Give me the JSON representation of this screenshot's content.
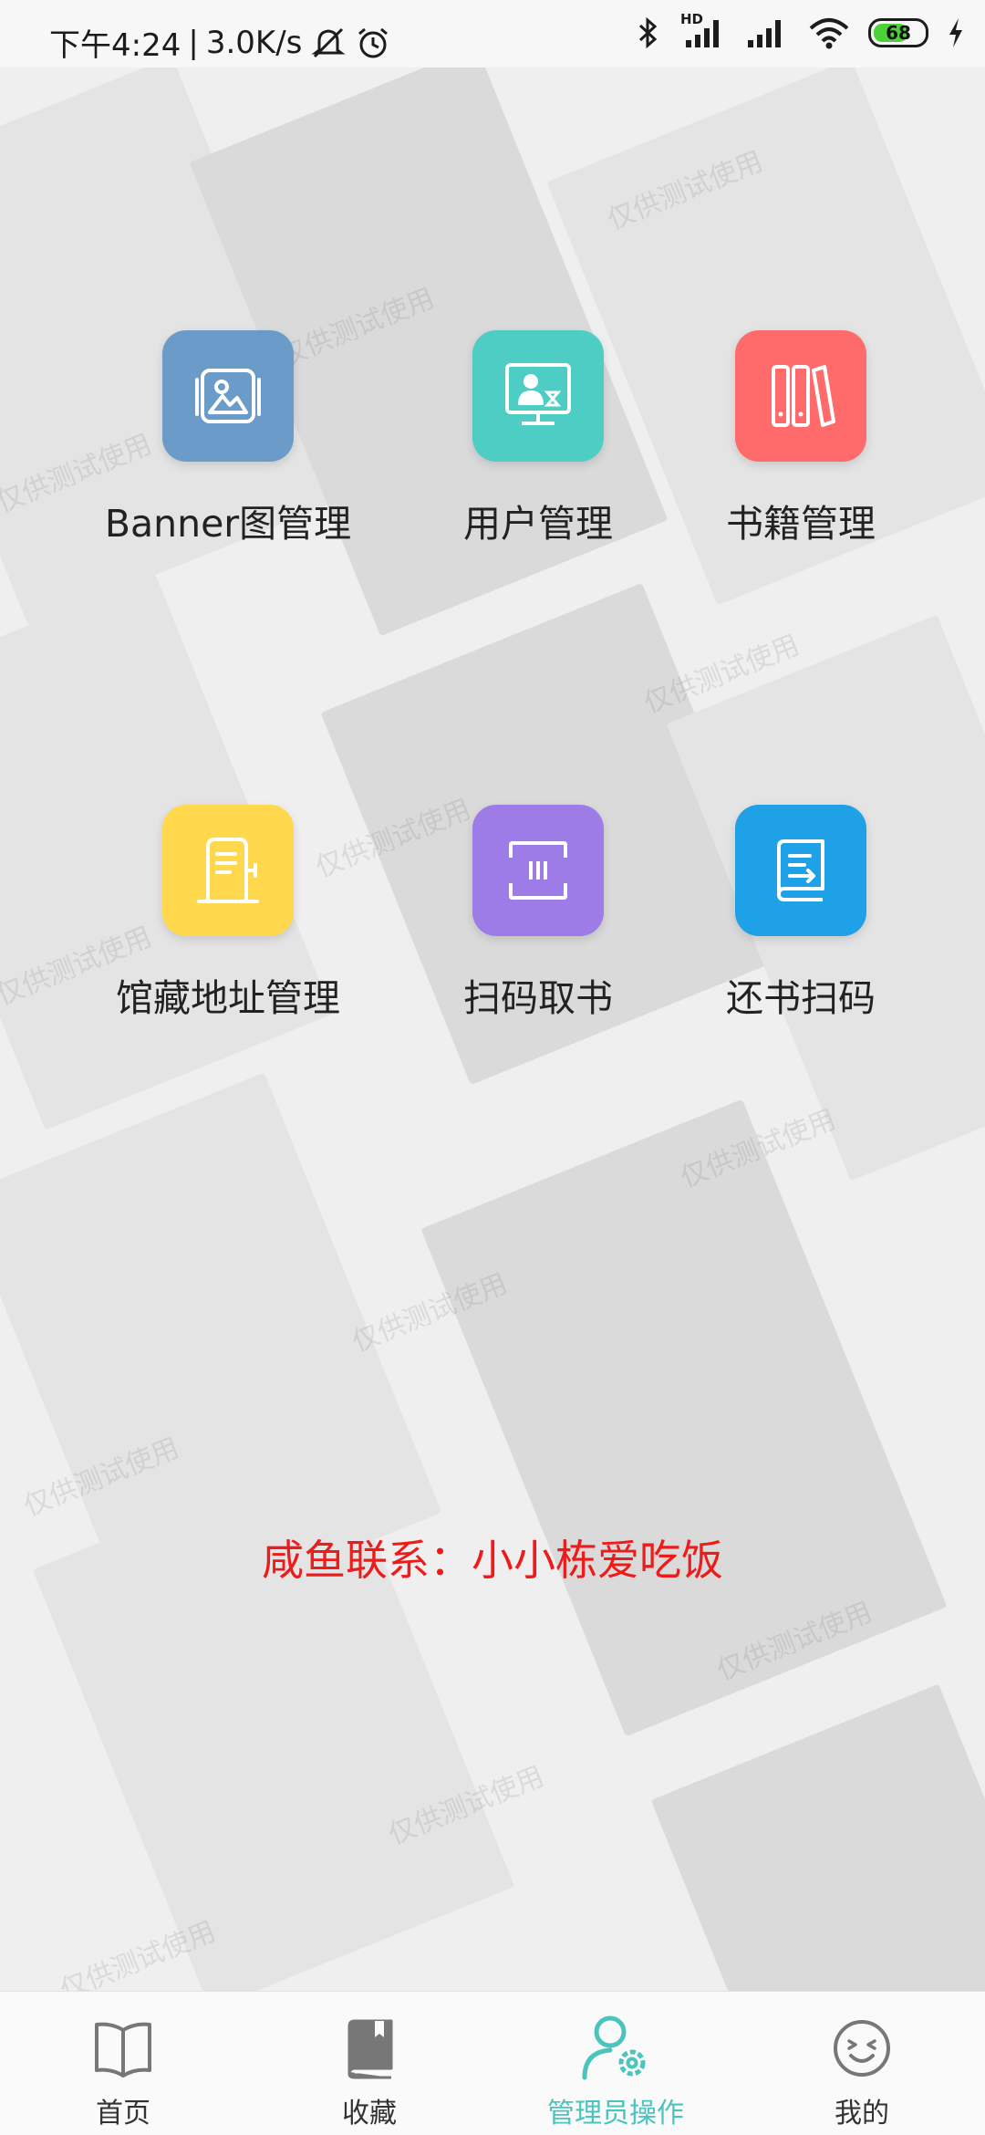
{
  "status_bar": {
    "time": "下午4:24",
    "separator": "|",
    "net_speed": "3.0K/s",
    "hd_label": "HD",
    "battery_level": "68",
    "battery_fraction": 0.68,
    "icons": [
      "mute-bell-icon",
      "alarm-icon",
      "bluetooth-icon",
      "signal-icon",
      "signal-icon",
      "wifi-icon",
      "battery-icon",
      "charging-icon"
    ]
  },
  "watermark": {
    "text": "仅供测试使用"
  },
  "admin_grid": {
    "items": [
      {
        "label": "Banner图管理",
        "color": "#6b9bc8",
        "icon": "image-gallery-icon"
      },
      {
        "label": "用户管理",
        "color": "#4ecdc4",
        "icon": "user-monitor-icon"
      },
      {
        "label": "书籍管理",
        "color": "#ff6b6b",
        "icon": "books-icon"
      },
      {
        "label": "馆藏地址管理",
        "color": "#ffd84d",
        "icon": "podium-icon"
      },
      {
        "label": "扫码取书",
        "color": "#9d7ce8",
        "icon": "scan-icon"
      },
      {
        "label": "还书扫码",
        "color": "#1ea1e6",
        "icon": "book-return-icon"
      }
    ]
  },
  "contact_note": "咸鱼联系：小小栋爱吃饭",
  "bottom_nav": {
    "active_color": "#4bc4bd",
    "items": [
      {
        "label": "首页",
        "icon": "open-book-icon",
        "active": false
      },
      {
        "label": "收藏",
        "icon": "closed-book-icon",
        "active": false
      },
      {
        "label": "管理员操作",
        "icon": "user-gear-icon",
        "active": true
      },
      {
        "label": "我的",
        "icon": "smiley-icon",
        "active": false
      }
    ]
  }
}
